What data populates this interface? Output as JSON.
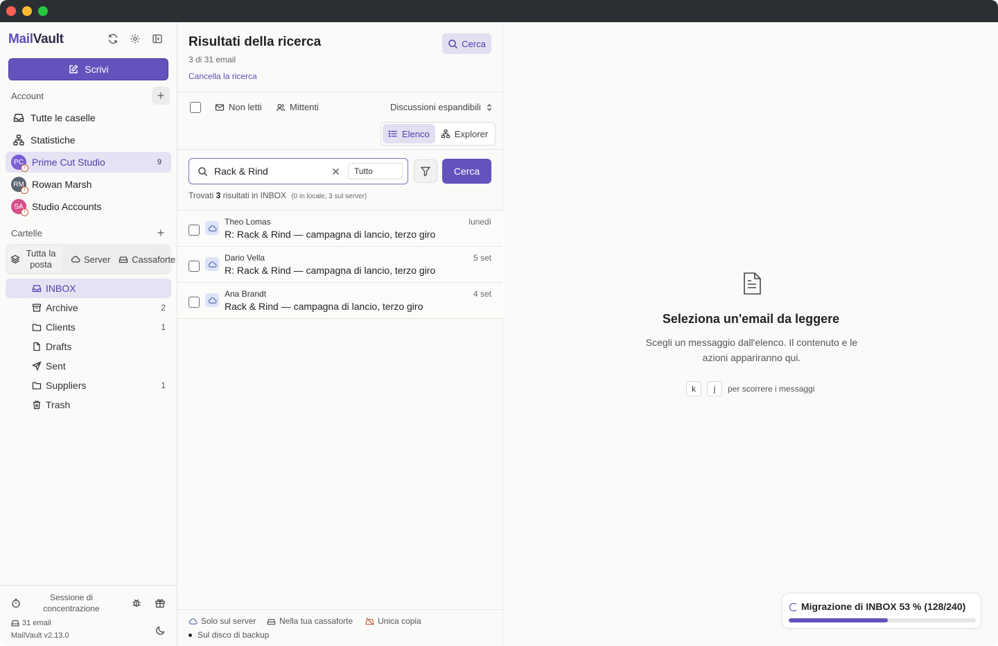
{
  "app": {
    "logo_mail": "Mail",
    "logo_vault": "Vault",
    "compose_label": "Scrivi"
  },
  "sidebar": {
    "account_label": "Account",
    "add_symbol": "+",
    "items": [
      {
        "label": "Tutte le caselle",
        "icon": "inbox-tray-icon"
      },
      {
        "label": "Statistiche",
        "icon": "sitemap-icon"
      }
    ],
    "accounts": [
      {
        "label": "Prime Cut Studio",
        "initials": "PC",
        "count": "9",
        "color": "#7b5fd6"
      },
      {
        "label": "Rowan Marsh",
        "initials": "RM",
        "count": "",
        "color": "#5a6672"
      },
      {
        "label": "Studio Accounts",
        "initials": "SA",
        "count": "",
        "color": "#d64f8c"
      }
    ],
    "folders_label": "Cartelle",
    "segments": {
      "all": "Tutta la posta",
      "server": "Server",
      "vault": "Cassaforte"
    },
    "folders": [
      {
        "label": "INBOX",
        "count": "",
        "icon": "inbox-icon"
      },
      {
        "label": "Archive",
        "count": "2",
        "icon": "archive-icon"
      },
      {
        "label": "Clients",
        "count": "1",
        "icon": "folder-icon"
      },
      {
        "label": "Drafts",
        "count": "",
        "icon": "file-icon"
      },
      {
        "label": "Sent",
        "count": "",
        "icon": "send-icon"
      },
      {
        "label": "Suppliers",
        "count": "1",
        "icon": "folder-icon"
      },
      {
        "label": "Trash",
        "count": "",
        "icon": "trash-icon"
      }
    ],
    "footer": {
      "focus_session": "Sessione di concentrazione",
      "email_count": "31 email",
      "version": "MailVault v2.13.0"
    }
  },
  "search_results": {
    "title": "Risultati della ricerca",
    "subtitle": "3 di 31 email",
    "clear_link": "Cancella la ricerca",
    "top_search_label": "Cerca",
    "toolbar": {
      "unread": "Non letti",
      "senders": "Mittenti",
      "threads": "Discussioni espandibili",
      "view_list": "Elenco",
      "view_explorer": "Explorer"
    },
    "search": {
      "query": "Rack & Rind",
      "scope": "Tutto",
      "button": "Cerca"
    },
    "found": {
      "prefix": "Trovati",
      "count": "3",
      "suffix": "risultati in INBOX",
      "detail": "(0 in locale, 3 sul server)"
    },
    "messages": [
      {
        "sender": "Theo Lomas",
        "subject": "R: Rack & Rind — campagna di lancio, terzo giro",
        "date": "lunedì"
      },
      {
        "sender": "Dario Vella",
        "subject": "R: Rack & Rind — campagna di lancio, terzo giro",
        "date": "5 set"
      },
      {
        "sender": "Ana Brandt",
        "subject": "Rack & Rind — campagna di lancio, terzo giro",
        "date": "4 set"
      }
    ],
    "legend": {
      "server_only": "Solo sul server",
      "in_vault": "Nella tua cassaforte",
      "single_copy": "Unica copia",
      "backup_disk": "Sul disco di backup"
    }
  },
  "reader": {
    "empty_title": "Seleziona un'email da leggere",
    "empty_text": "Scegli un messaggio dall'elenco. Il contenuto e le azioni appariranno qui.",
    "key_k": "k",
    "key_j": "j",
    "key_hint": "per scorrere i messaggi"
  },
  "migration": {
    "label": "Migrazione di INBOX 53 % (128/240)",
    "progress": 0.53
  },
  "colors": {
    "accent": "#6452bd",
    "accent_light": "#e3dff2"
  }
}
